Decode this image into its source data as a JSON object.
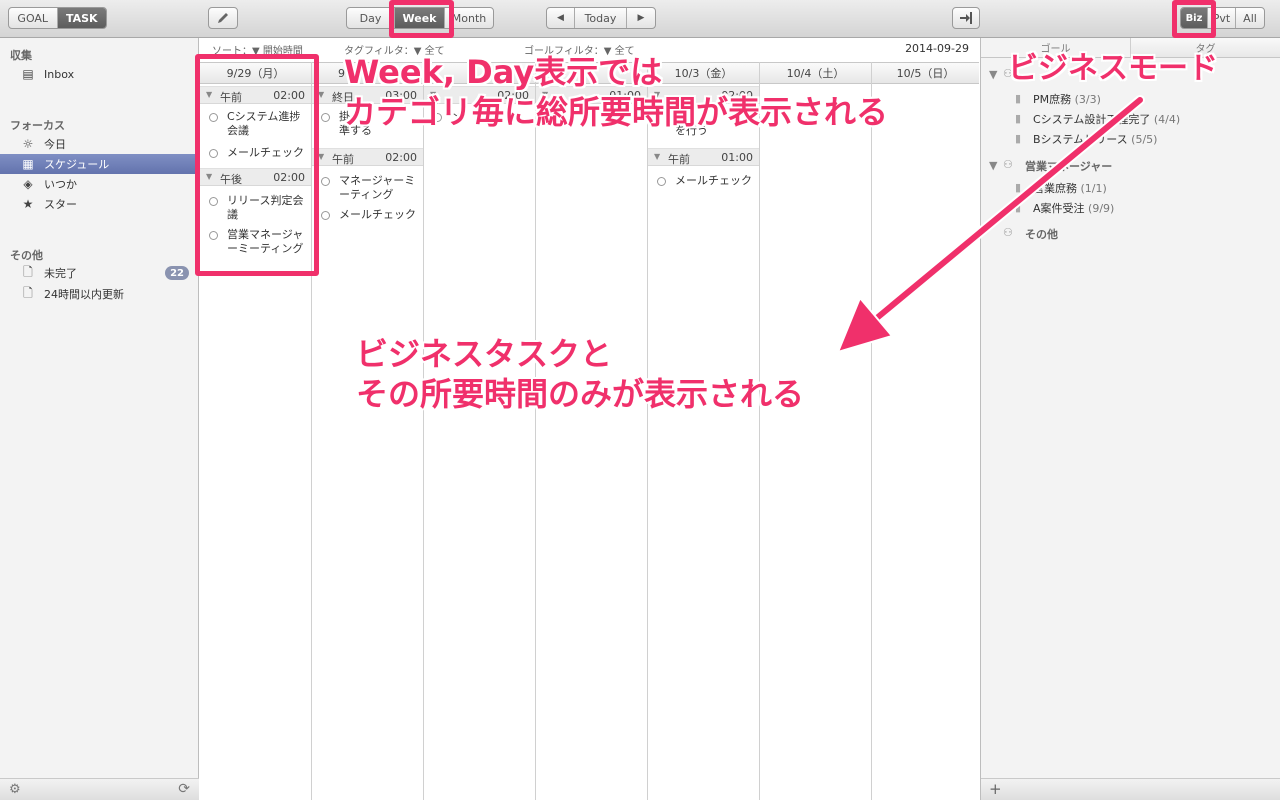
{
  "toolbar": {
    "goal": "GOAL",
    "task": "TASK",
    "view_day": "Day",
    "view_week": "Week",
    "view_month": "Month",
    "today": "Today",
    "prev_glyph": "◀",
    "next_glyph": "▶",
    "mode_biz": "Biz",
    "mode_pvt": "Pvt",
    "mode_all": "All"
  },
  "sidebar": {
    "collect_head": "収集",
    "inbox": "Inbox",
    "focus_head": "フォーカス",
    "today": "今日",
    "schedule": "スケジュール",
    "someday": "いつか",
    "star": "スター",
    "other_head": "その他",
    "incomplete": "未完了",
    "incomplete_count": "22",
    "updated_24h": "24時間以内更新"
  },
  "filters": {
    "sort": "ソート：▼ 開始時間",
    "tag": "タグフィルタ：▼ 全て",
    "goal": "ゴールフィルタ：▼ 全て",
    "date": "2014-09-29"
  },
  "columns": [
    {
      "header": "9/29（月）"
    },
    {
      "header": "9"
    },
    {
      "header": ""
    },
    {
      "header": ""
    },
    {
      "header": "10/3（金）"
    },
    {
      "header": "10/4（土）"
    },
    {
      "header": "10/5（日）"
    }
  ],
  "day0": {
    "am_label": "午前",
    "am_time": "02:00",
    "t1": "Cシステム進捗会議",
    "t2": "メールチェック",
    "pm_label": "午後",
    "pm_time": "02:00",
    "t3": "リリース判定会議",
    "t4": "営業マネージャーミーティング"
  },
  "day1": {
    "allday_label": "終日",
    "allday_time": "03:00",
    "t1": "掛",
    "t1b": "準する",
    "am_label": "午前",
    "am_time": "02:00",
    "t2": "マネージャーミーティング",
    "t3": "メールチェック"
  },
  "day2": {
    "allday_time": "02:00",
    "t1": "メ"
  },
  "day3": {
    "allday_time": "01:00"
  },
  "day4": {
    "allday_time": "02:00",
    "t1": "を行う",
    "am_label": "午前",
    "am_time": "01:00",
    "t2": "メールチェック"
  },
  "rpanel": {
    "tab_goal": "ゴール",
    "tab_tag": "タグ",
    "g1": "PM庶務",
    "g1_cnt": "(3/3)",
    "g2": "Cシステム設計工程完了",
    "g2_cnt": "(4/4)",
    "g3": "Bシステムリリース",
    "g3_cnt": "(5/5)",
    "p2": "営業マネージャー",
    "g4": "営業庶務",
    "g4_cnt": "(1/1)",
    "g5": "A案件受注",
    "g5_cnt": "(9/9)",
    "p3": "その他",
    "add": "+"
  },
  "annotations": {
    "a1_line1": "Week, Day表示では",
    "a1_line2": "カテゴリ毎に総所要時間が表示される",
    "a2": "ビジネスモード",
    "a3_line1": "ビジネスタスクと",
    "a3_line2": "その所要時間のみが表示される"
  },
  "colors": {
    "accent": "#f0306b",
    "selection": "#6f7fb9"
  }
}
